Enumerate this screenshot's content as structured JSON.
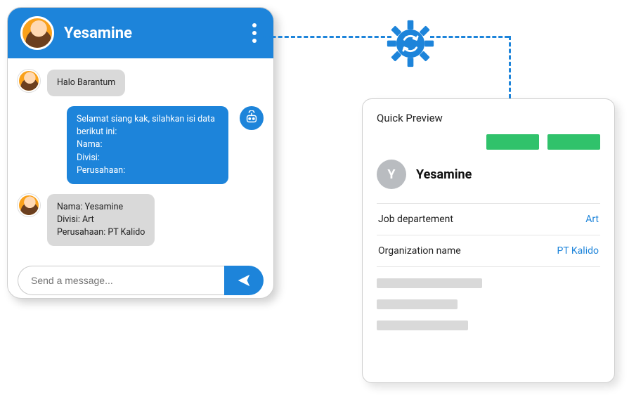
{
  "chat": {
    "title": "Yesamine",
    "messages": {
      "m1": "Halo Barantum",
      "m2": "Selamat siang kak, silahkan isi data berikut ini:\nNama:\nDivisi:\nPerusahaan:",
      "m3": "Nama: Yesamine\nDivisi: Art\nPerusahaan: PT Kalido"
    },
    "input_placeholder": "Send a message..."
  },
  "preview": {
    "title": "Quick Preview",
    "initial": "Y",
    "name": "Yesamine",
    "fields": {
      "job_label": "Job departement",
      "job_value": "Art",
      "org_label": "Organization name",
      "org_value": "PT Kalido"
    }
  }
}
